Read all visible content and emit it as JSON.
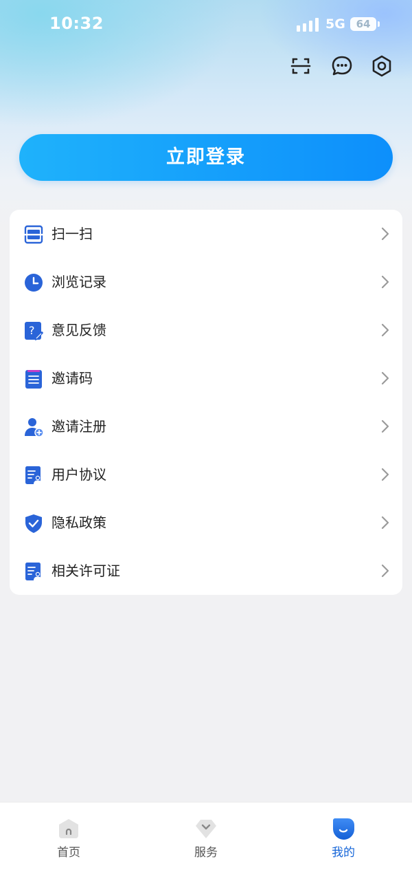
{
  "status_bar": {
    "time": "10:32",
    "network": "5G",
    "battery": "64"
  },
  "header": {
    "icons": [
      "scan-icon",
      "message-icon",
      "settings-icon"
    ]
  },
  "login": {
    "label": "立即登录"
  },
  "menu": {
    "items": [
      {
        "label": "扫一扫",
        "icon": "scan-frame-icon"
      },
      {
        "label": "浏览记录",
        "icon": "clock-icon"
      },
      {
        "label": "意见反馈",
        "icon": "feedback-icon"
      },
      {
        "label": "邀请码",
        "icon": "notepad-icon"
      },
      {
        "label": "邀请注册",
        "icon": "add-user-icon"
      },
      {
        "label": "用户协议",
        "icon": "document-user-icon"
      },
      {
        "label": "隐私政策",
        "icon": "shield-check-icon"
      },
      {
        "label": "相关许可证",
        "icon": "license-icon"
      }
    ]
  },
  "tabbar": {
    "tabs": [
      {
        "label": "首页",
        "icon": "home-icon",
        "active": false
      },
      {
        "label": "服务",
        "icon": "service-icon",
        "active": false
      },
      {
        "label": "我的",
        "icon": "profile-icon",
        "active": true
      }
    ]
  },
  "colors": {
    "accent": "#1565d8",
    "login_gradient_start": "#1fb2fb",
    "login_gradient_end": "#0d8ffb",
    "icon_blue": "#2a64d8"
  }
}
